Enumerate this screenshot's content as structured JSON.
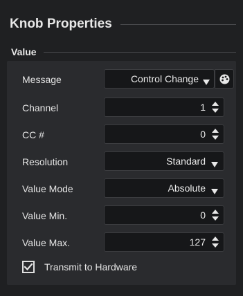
{
  "panel": {
    "title": "Knob Properties"
  },
  "section": {
    "title": "Value"
  },
  "rows": {
    "message": {
      "label": "Message",
      "value": "Control Change"
    },
    "channel": {
      "label": "Channel",
      "value": "1"
    },
    "cc": {
      "label": "CC #",
      "value": "0"
    },
    "resolution": {
      "label": "Resolution",
      "value": "Standard"
    },
    "value_mode": {
      "label": "Value Mode",
      "value": "Absolute"
    },
    "value_min": {
      "label": "Value Min.",
      "value": "0"
    },
    "value_max": {
      "label": "Value Max.",
      "value": "127"
    }
  },
  "transmit": {
    "label": "Transmit to Hardware",
    "checked": true
  },
  "icons": {
    "dropdown": "dropdown-arrow-icon",
    "spin": "spin-arrows-icon",
    "learn": "palette-icon",
    "check": "checkmark-icon"
  },
  "colors": {
    "background": "#1f2022",
    "field": "#161719",
    "group": "#2a2b2e",
    "text": "#e6e6e6"
  }
}
